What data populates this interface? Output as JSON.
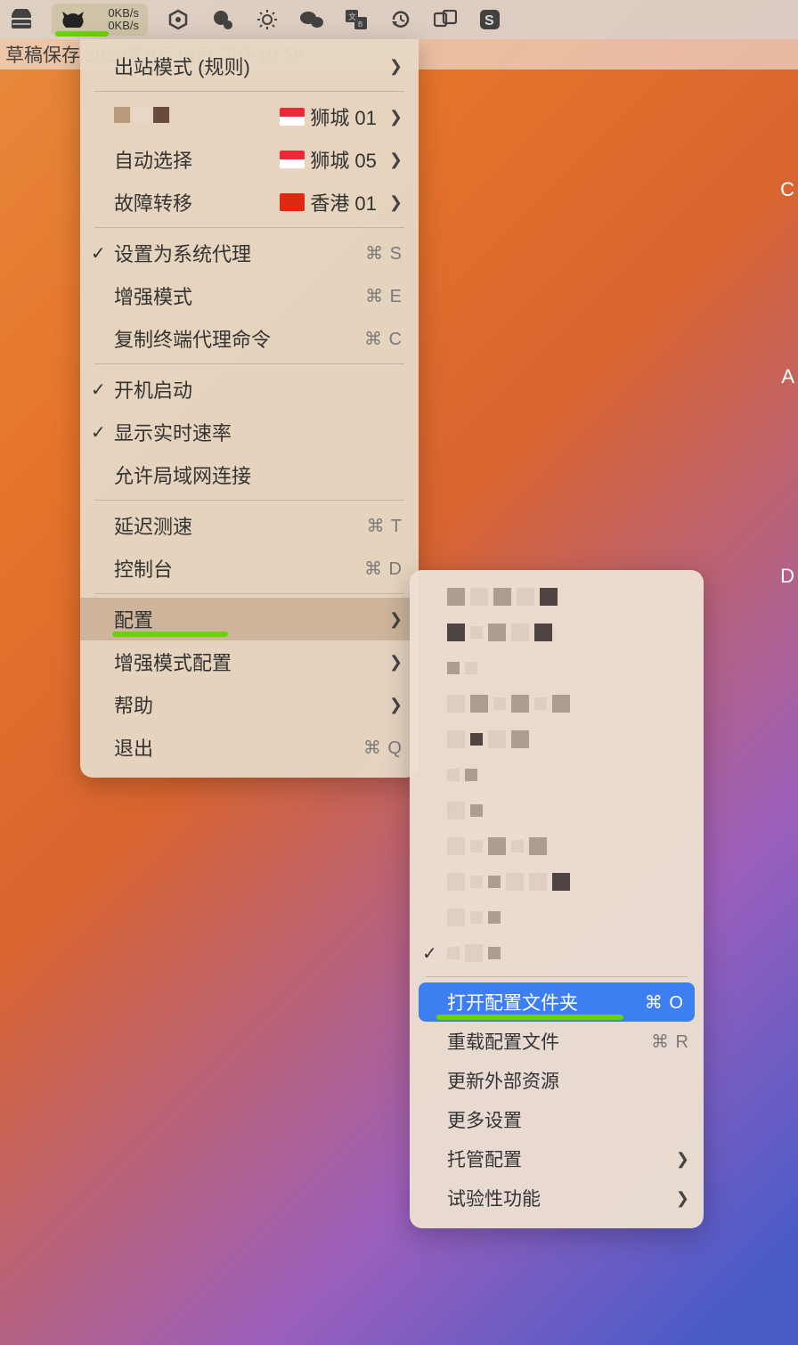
{
  "menubar": {
    "speed_up": "0KB/s",
    "speed_down": "0KB/s"
  },
  "background_title": "草稿保存                               2023年6月14日 下午10:56",
  "mainMenu": {
    "outbound": "出站模式 (规则)",
    "proxy_rows": [
      {
        "label": "",
        "node_label": "狮城 01",
        "flag": "sg"
      },
      {
        "label": "自动选择",
        "node_label": "狮城 05",
        "flag": "sg"
      },
      {
        "label": "故障转移",
        "node_label": "香港 01",
        "flag": "hk"
      }
    ],
    "system_proxy": {
      "label": "设置为系统代理",
      "shortcut": "⌘ S",
      "checked": true
    },
    "enhance_mode": {
      "label": "增强模式",
      "shortcut": "⌘ E"
    },
    "copy_shell": {
      "label": "复制终端代理命令",
      "shortcut": "⌘ C"
    },
    "autostart": {
      "label": "开机启动",
      "checked": true
    },
    "show_speed": {
      "label": "显示实时速率",
      "checked": true
    },
    "allow_lan": {
      "label": "允许局域网连接"
    },
    "latency": {
      "label": "延迟测速",
      "shortcut": "⌘ T"
    },
    "console": {
      "label": "控制台",
      "shortcut": "⌘ D"
    },
    "config": {
      "label": "配置"
    },
    "enhance_cfg": {
      "label": "增强模式配置"
    },
    "help": {
      "label": "帮助"
    },
    "quit": {
      "label": "退出",
      "shortcut": "⌘ Q"
    }
  },
  "submenu": {
    "open_folder": {
      "label": "打开配置文件夹",
      "shortcut": "⌘ O"
    },
    "reload": {
      "label": "重载配置文件",
      "shortcut": "⌘ R"
    },
    "update_resources": {
      "label": "更新外部资源"
    },
    "more_settings": {
      "label": "更多设置"
    },
    "managed": {
      "label": "托管配置"
    },
    "experimental": {
      "label": "试验性功能"
    }
  },
  "right_edge": {
    "c": "C",
    "a": "A",
    "d": "D"
  }
}
